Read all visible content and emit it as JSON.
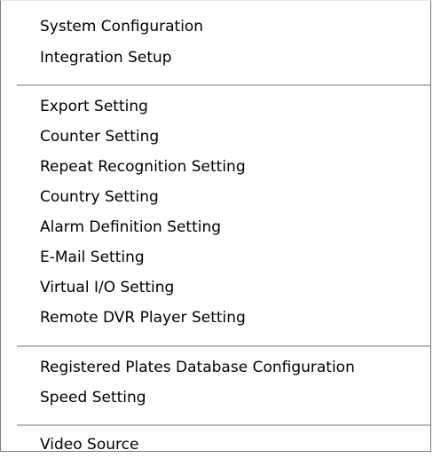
{
  "menu": {
    "groups": [
      {
        "items": [
          {
            "label": "System Configuration"
          },
          {
            "label": "Integration Setup"
          }
        ]
      },
      {
        "items": [
          {
            "label": "Export Setting"
          },
          {
            "label": "Counter Setting"
          },
          {
            "label": "Repeat Recognition Setting"
          },
          {
            "label": "Country Setting"
          },
          {
            "label": "Alarm Definition Setting"
          },
          {
            "label": "E-Mail Setting"
          },
          {
            "label": "Virtual I/O Setting"
          },
          {
            "label": "Remote DVR Player Setting"
          }
        ]
      },
      {
        "items": [
          {
            "label": "Registered Plates Database Configuration"
          },
          {
            "label": "Speed Setting"
          }
        ]
      },
      {
        "items": [
          {
            "label": "Video Source"
          }
        ]
      }
    ]
  }
}
